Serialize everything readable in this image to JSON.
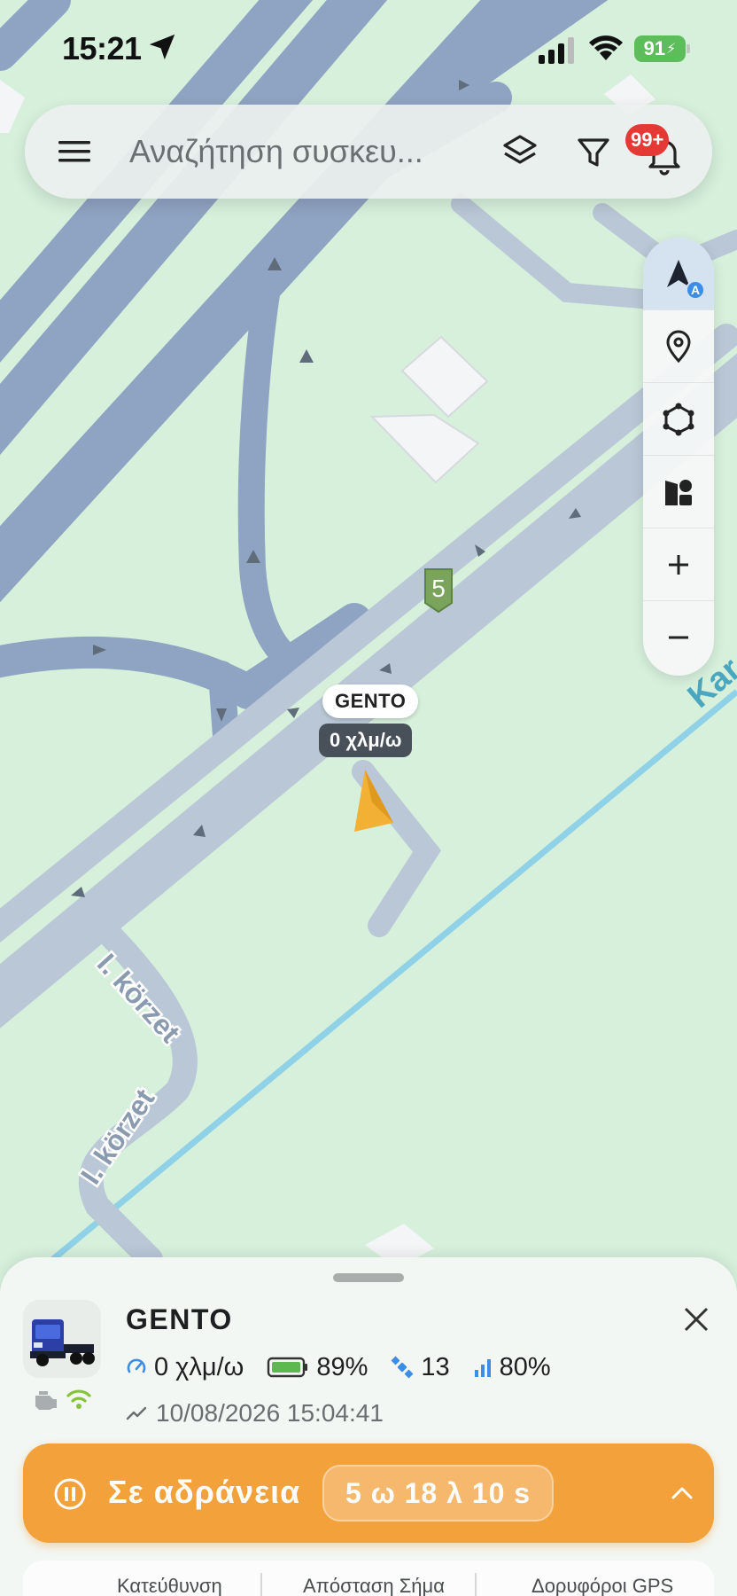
{
  "status_bar": {
    "time": "15:21",
    "battery": "91"
  },
  "search": {
    "placeholder": "Αναζήτηση συσκευ...",
    "notifications_badge": "99+"
  },
  "tools": [
    "navigation-arrow-icon",
    "location-pin-icon",
    "polygon-geofence-icon",
    "shapes-icon",
    "zoom-in-icon",
    "zoom-out-icon"
  ],
  "map": {
    "route_shield": "5",
    "street_labels": [
      "I. körzet",
      "I. körzet",
      "Kar"
    ],
    "vehicle_label": "GENTO",
    "vehicle_speed": "0 χλμ/ω",
    "colors": {
      "land": "#d6f0dc",
      "major_road": "#8fa3c2",
      "minor_road": "#b9c7d6",
      "rail": "#8fd1e6",
      "vehicle": "#f2b134"
    }
  },
  "sheet": {
    "device_name": "GENTO",
    "speed": "0 χλμ/ω",
    "battery": "89%",
    "satellites": "13",
    "signal": "80%",
    "last_update": "10/08/2026 15:04:41",
    "status_label": "Σε αδράνεια",
    "status_duration": "5 ω 18 λ 10 s",
    "tabs": [
      "Κατεύθυνση",
      "Απόσταση Σήμα",
      "Δορυφόροι GPS"
    ]
  },
  "accent_color": "#f2a13b"
}
